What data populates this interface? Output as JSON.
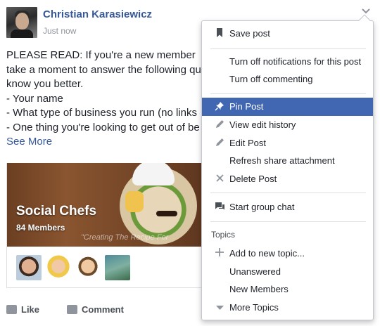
{
  "post": {
    "author": "Christian Karasiewicz",
    "timestamp": "Just now",
    "body_lines": [
      "PLEASE READ: If you're a new member",
      "take a moment to answer the following qu",
      "know you better.",
      "- Your name",
      "- What type of business you run (no links",
      "- One thing you're looking to get out of be"
    ],
    "see_more": "See More"
  },
  "group_card": {
    "name": "Social Chefs",
    "members": "84 Members",
    "tagline": "\"Creating The Recipe For"
  },
  "actions": {
    "like": "Like",
    "comment": "Comment"
  },
  "menu": {
    "items": [
      {
        "label": "Save post",
        "icon": "bookmark-icon"
      },
      {
        "label": "Turn off notifications for this post",
        "icon": ""
      },
      {
        "label": "Turn off commenting",
        "icon": ""
      },
      {
        "label": "Pin Post",
        "icon": "pin-icon"
      },
      {
        "label": "View edit history",
        "icon": "pencil-icon"
      },
      {
        "label": "Edit Post",
        "icon": "pencil-icon"
      },
      {
        "label": "Refresh share attachment",
        "icon": ""
      },
      {
        "label": "Delete Post",
        "icon": "close-icon"
      },
      {
        "label": "Start group chat",
        "icon": "chat-icon"
      },
      {
        "label": "Add to new topic...",
        "icon": "plus-icon"
      },
      {
        "label": "Unanswered",
        "icon": ""
      },
      {
        "label": "New Members",
        "icon": ""
      },
      {
        "label": "More Topics",
        "icon": "caret-down-icon"
      }
    ],
    "topics_header": "Topics",
    "highlight_color": "#4267b2"
  },
  "colors": {
    "link": "#365899",
    "text": "#1d2129",
    "muted": "#90949c"
  }
}
